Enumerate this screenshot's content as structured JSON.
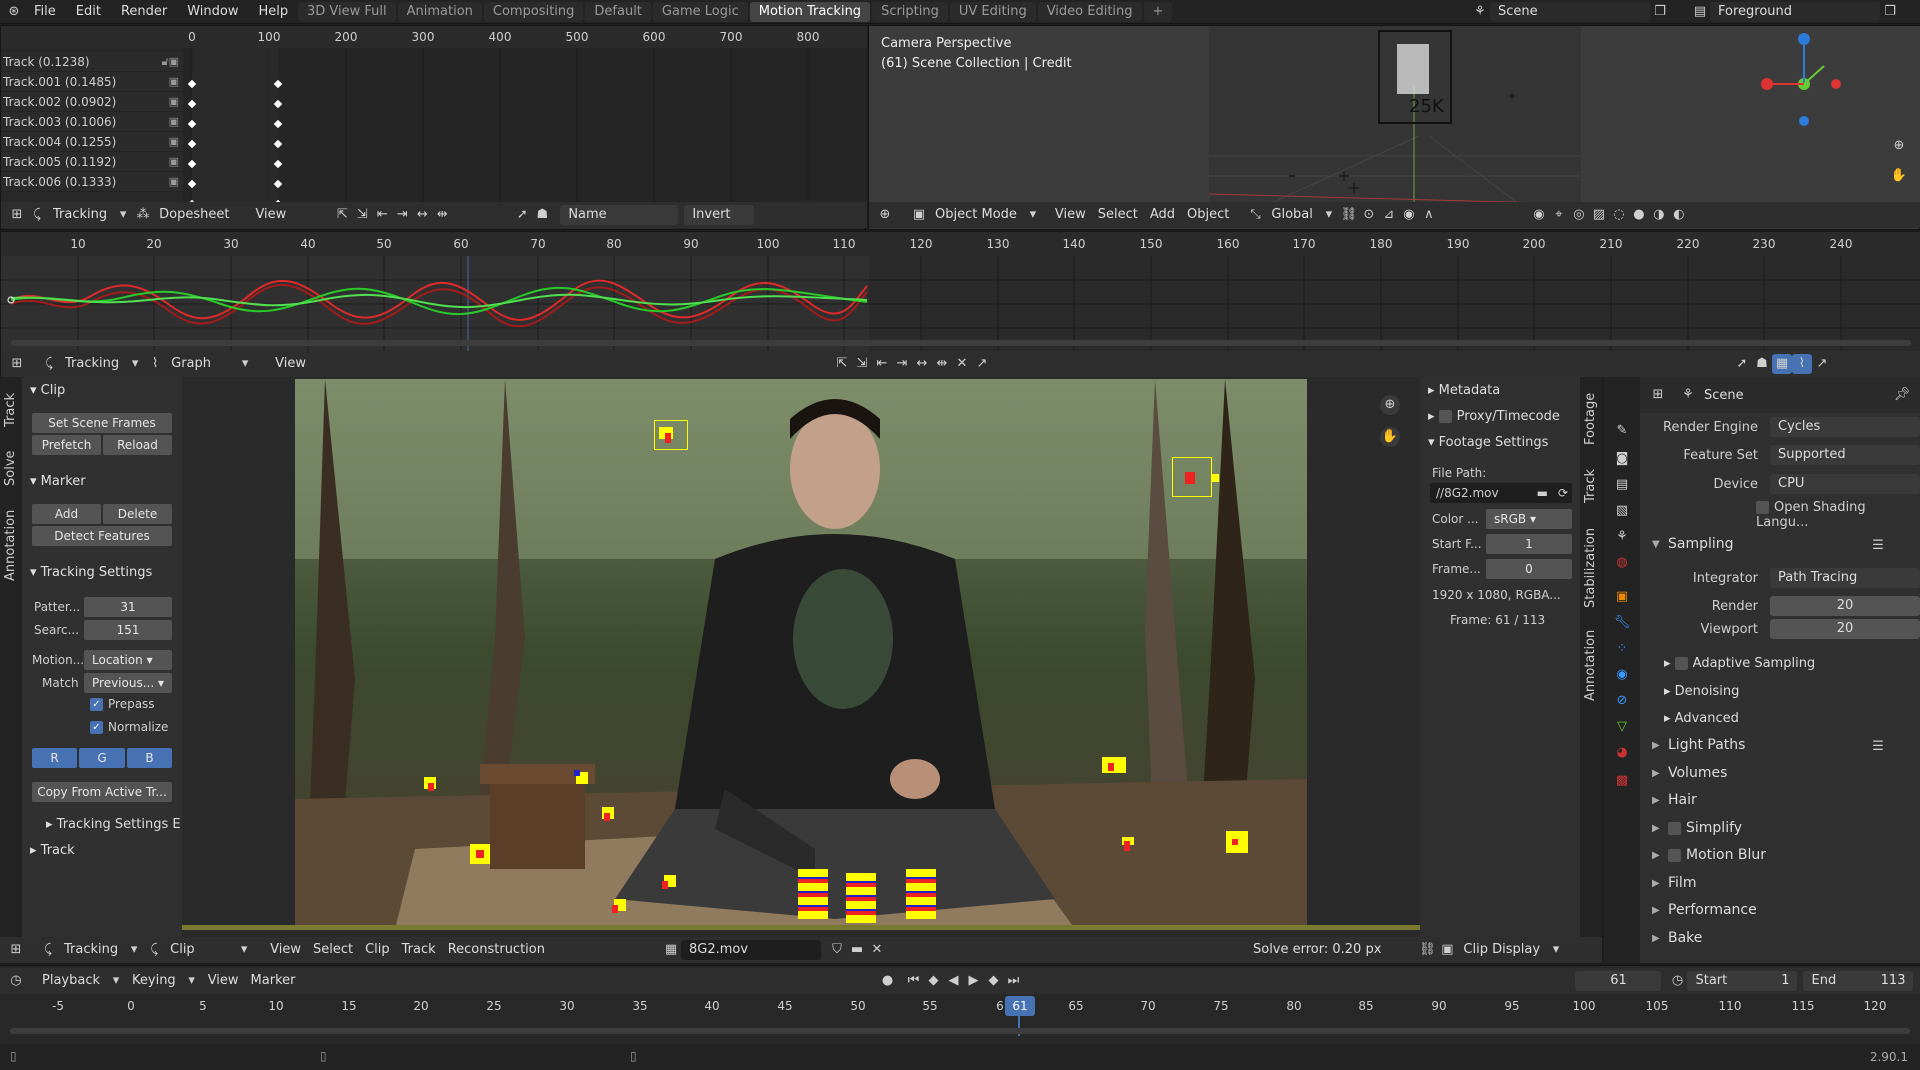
{
  "topbar": {
    "menus": [
      "File",
      "Edit",
      "Render",
      "Window",
      "Help"
    ],
    "workspace_tabs": [
      "3D View Full",
      "Animation",
      "Compositing",
      "Default",
      "Game Logic",
      "Motion Tracking",
      "Scripting",
      "UV Editing",
      "Video Editing"
    ],
    "active_tab": "Motion Tracking",
    "add_tab": "+",
    "scene": "Scene",
    "view_layer": "Foreground"
  },
  "dopesheet": {
    "ticks": [
      "0",
      "100",
      "200",
      "300",
      "400",
      "500",
      "600",
      "700",
      "800"
    ],
    "tracks": [
      "Track (0.1238)",
      "Track.001 (0.1485)",
      "Track.002 (0.0902)",
      "Track.003 (0.1006)",
      "Track.004 (0.1255)",
      "Track.005 (0.1192)",
      "Track.006 (0.1333)"
    ],
    "header": {
      "mode": "Tracking",
      "view_type": "Dopesheet",
      "view": "View",
      "sort": "Name",
      "invert": "Invert"
    }
  },
  "viewport3d": {
    "overlay_title": "Camera Perspective",
    "overlay_sub": "(61) Scene Collection | Credit",
    "cam_label": "25K",
    "header": {
      "mode": "Object Mode",
      "view": "View",
      "select": "Select",
      "add": "Add",
      "object": "Object",
      "orientation": "Global"
    }
  },
  "graph": {
    "ticks": [
      "10",
      "20",
      "30",
      "40",
      "50",
      "60",
      "70",
      "80",
      "90",
      "100",
      "110",
      "120",
      "130",
      "140",
      "150",
      "160",
      "170",
      "180",
      "190",
      "200",
      "210",
      "220",
      "230",
      "240"
    ],
    "header": {
      "mode": "Tracking",
      "view_type": "Graph",
      "view": "View"
    }
  },
  "clip_sidebar": {
    "tabs": [
      "Track",
      "Solve",
      "Annotation"
    ],
    "clip": {
      "title": "Clip",
      "set_scene_frames": "Set Scene Frames",
      "prefetch": "Prefetch",
      "reload": "Reload"
    },
    "marker": {
      "title": "Marker",
      "add": "Add",
      "delete": "Delete",
      "detect": "Detect Features"
    },
    "tracking_settings": {
      "title": "Tracking Settings",
      "pattern_label": "Patter...",
      "pattern_value": "31",
      "search_label": "Searc...",
      "search_value": "151",
      "motion_label": "Motion...",
      "motion_value": "Location",
      "match_label": "Match",
      "match_value": "Previous...",
      "prepass": "Prepass",
      "normalize": "Normalize",
      "r": "R",
      "g": "G",
      "b": "B",
      "copy": "Copy From Active Tr...",
      "extra": "Tracking Settings E"
    },
    "track": {
      "title": "Track"
    }
  },
  "clip_right": {
    "tabs": [
      "Footage",
      "Track",
      "Stabilization",
      "Annotation"
    ],
    "metadata": "Metadata",
    "proxy": "Proxy/Timecode",
    "footage_settings": "Footage Settings",
    "file_path_label": "File Path:",
    "file_path": "//8G2.mov",
    "color_label": "Color ...",
    "color_value": "sRGB",
    "start_label": "Start F...",
    "start_value": "1",
    "frame_label": "Frame...",
    "frame_value": "0",
    "resolution": "1920 x 1080, RGBA...",
    "frame_info": "Frame: 61 / 113"
  },
  "clip_header": {
    "mode": "Tracking",
    "view_type": "Clip",
    "view": "View",
    "select": "Select",
    "clip": "Clip",
    "track": "Track",
    "reconstruction": "Reconstruction",
    "clip_name": "8G2.mov",
    "solve_error": "Solve error: 0.20 px",
    "clip_display": "Clip Display"
  },
  "properties": {
    "scene": "Scene",
    "render_engine_label": "Render Engine",
    "render_engine": "Cycles",
    "feature_set_label": "Feature Set",
    "feature_set": "Supported",
    "device_label": "Device",
    "device": "CPU",
    "osl": "Open Shading Langu...",
    "sampling": "Sampling",
    "integrator_label": "Integrator",
    "integrator": "Path Tracing",
    "render_label": "Render",
    "render_value": "20",
    "viewport_label": "Viewport",
    "viewport_value": "20",
    "sub_sections": [
      "Adaptive Sampling",
      "Denoising",
      "Advanced"
    ],
    "sections": [
      "Light Paths",
      "Volumes",
      "Hair",
      "Simplify",
      "Motion Blur",
      "Film",
      "Performance",
      "Bake"
    ]
  },
  "timeline": {
    "playback": "Playback",
    "keying": "Keying",
    "view": "View",
    "marker": "Marker",
    "current_frame": "61",
    "start_label": "Start",
    "start": "1",
    "end_label": "End",
    "end": "113",
    "ticks": [
      "-5",
      "0",
      "5",
      "10",
      "15",
      "20",
      "25",
      "30",
      "35",
      "40",
      "45",
      "50",
      "55",
      "6",
      "65",
      "70",
      "75",
      "80",
      "85",
      "90",
      "95",
      "100",
      "105",
      "110",
      "115",
      "120"
    ],
    "frame_badge": "61",
    "version": "2.90.1"
  },
  "colors": {
    "accent": "#4772b3",
    "active_tab": "#454545",
    "marker_yellow": "#ffff00",
    "track_red": "#e03030",
    "track_green": "#30d030"
  }
}
